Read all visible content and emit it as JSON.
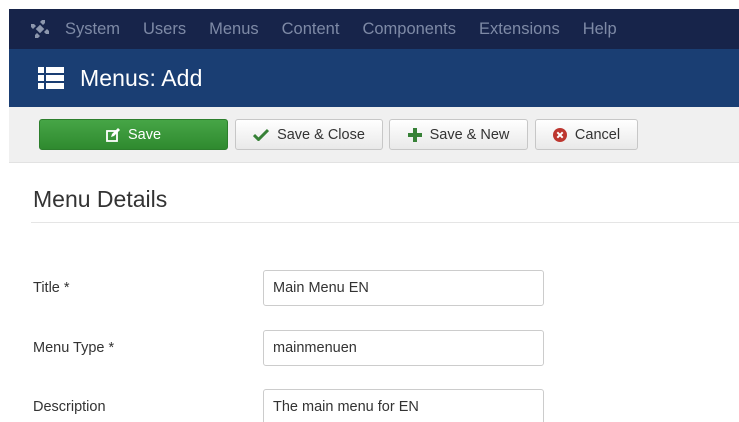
{
  "topbar": {
    "logo_icon": "joomla-logo-icon",
    "menu": [
      "System",
      "Users",
      "Menus",
      "Content",
      "Components",
      "Extensions",
      "Help"
    ]
  },
  "titlebar": {
    "icon": "list-icon",
    "title": "Menus: Add"
  },
  "toolbar": {
    "save_label": "Save",
    "save_close_label": "Save & Close",
    "save_new_label": "Save & New",
    "cancel_label": "Cancel"
  },
  "section": {
    "title": "Menu Details"
  },
  "form": {
    "fields": [
      {
        "label": "Title *",
        "value": "Main Menu EN"
      },
      {
        "label": "Menu Type *",
        "value": "mainmenuen"
      },
      {
        "label": "Description",
        "value": "The main menu for EN"
      }
    ]
  },
  "colors": {
    "topbar_bg": "#17244a",
    "titlebar_bg": "#1a3e73",
    "save_green": "#3d9b3d",
    "cancel_red": "#bd362f",
    "check_green": "#378137"
  }
}
